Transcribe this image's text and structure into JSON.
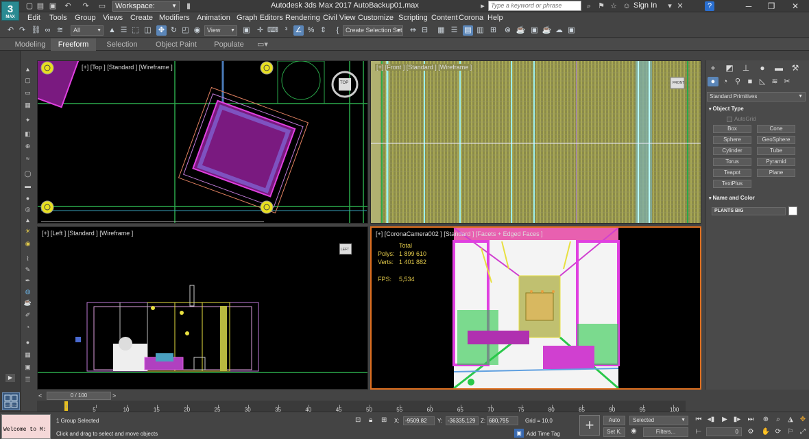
{
  "titlebar": {
    "logo_text": "3",
    "logo_sub": "MAX",
    "workspace_label": "Workspace: Default",
    "app_title": "Autodesk 3ds Max 2017    AutoBackup01.max",
    "search_placeholder": "Type a keyword or phrase",
    "signin_label": "Sign In",
    "help_label": "?"
  },
  "menus": [
    "Edit",
    "Tools",
    "Group",
    "Views",
    "Create",
    "Modifiers",
    "Animation",
    "Graph Editors",
    "Rendering",
    "Civil View",
    "Customize",
    "Scripting",
    "Content",
    "Corona",
    "Help"
  ],
  "toolbar": {
    "selection_filter": "All",
    "reference_coord": "View",
    "selection_set": "Create Selection Set"
  },
  "ribbon_tabs": [
    "Modeling",
    "Freeform",
    "Selection",
    "Object Paint",
    "Populate"
  ],
  "ribbon_active": "Freeform",
  "viewports": {
    "top_label": "[+] [Top ] [Standard ] [Wireframe ]",
    "front_label": "[+] [Front ] [Standard ] [Wireframe ]",
    "left_label": "[+] [Left ] [Standard ] [Wireframe ]",
    "persp_label": "[+] [CoronaCamera002 ] [Standard ] [Facets + Edged Faces ]",
    "viewcube_top": "TOP",
    "viewcube_front": "FRONT",
    "viewcube_left": "LEFT",
    "stats": {
      "total_label": "Total",
      "polys_label": "Polys:",
      "polys_value": "1 899 610",
      "verts_label": "Verts:",
      "verts_value": "1 401 882",
      "fps_label": "FPS:",
      "fps_value": "5,534"
    }
  },
  "command_panel": {
    "category": "Standard Primitives",
    "object_type_header": "Object Type",
    "autogrid_label": "AutoGrid",
    "buttons": [
      "Box",
      "Cone",
      "Sphere",
      "GeoSphere",
      "Cylinder",
      "Tube",
      "Torus",
      "Pyramid",
      "Teapot",
      "Plane",
      "TextPlus"
    ],
    "name_color_header": "Name and Color",
    "object_name": "PLANTS BIG"
  },
  "timeline": {
    "slider_label": "0 / 100",
    "ticks": [
      "0",
      "5",
      "10",
      "15",
      "20",
      "25",
      "30",
      "35",
      "40",
      "45",
      "50",
      "55",
      "60",
      "65",
      "70",
      "75",
      "80",
      "85",
      "90",
      "95",
      "100"
    ]
  },
  "statusbar": {
    "maxscript_text": "Welcome to M:",
    "selection_status": "1 Group Selected",
    "prompt": "Click and drag to select and move objects",
    "x_label": "X:",
    "x_value": "-9509,82",
    "y_label": "Y:",
    "y_value": "-36335,129",
    "z_label": "Z:",
    "z_value": "680,795",
    "grid_label": "Grid = 10,0",
    "add_time_tag": "Add Time Tag",
    "auto_label": "Auto",
    "setk_label": "Set K.",
    "selected_dropdown": "Selected",
    "filters_label": "Filters...",
    "frame_value": "0"
  },
  "colors": {
    "accent": "#5b86b8",
    "active_viewport_border": "#e07020",
    "stats_text": "#e0c84a"
  }
}
